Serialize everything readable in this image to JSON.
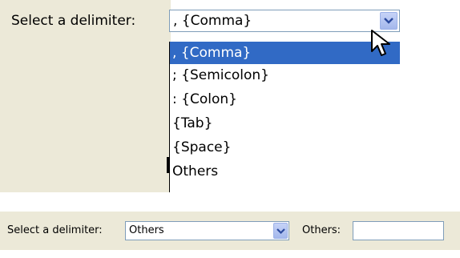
{
  "top": {
    "label": "Select a delimiter:",
    "selected_value": ", {Comma}",
    "options": [
      ", {Comma}",
      "; {Semicolon}",
      ": {Colon}",
      "{Tab}",
      "{Space}",
      "Others"
    ],
    "highlighted_index": 0
  },
  "bottom": {
    "label": "Select a delimiter:",
    "selected_value": "Others",
    "others_label": "Others:",
    "others_value": ""
  },
  "colors": {
    "panel_bg": "#ece9d8",
    "highlight": "#316ac5",
    "border": "#7f9db9"
  }
}
